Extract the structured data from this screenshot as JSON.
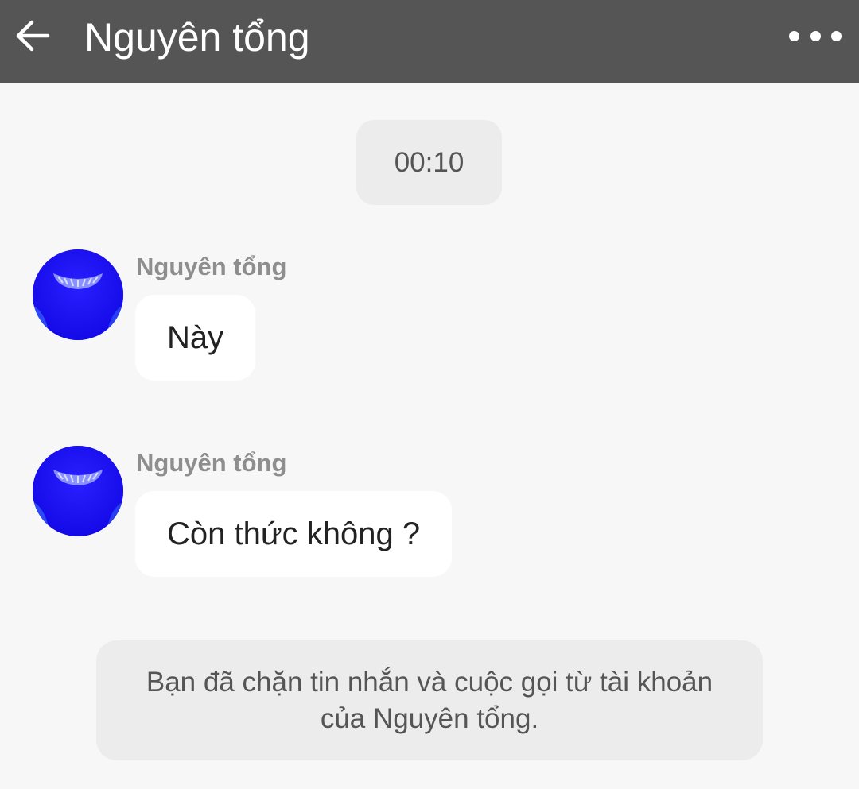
{
  "header": {
    "title": "Nguyên tổng",
    "back_icon": "arrow-left-icon",
    "more_icon": "more-horizontal-icon",
    "background_color": "#555555"
  },
  "chat": {
    "timestamp": "00:10",
    "messages": [
      {
        "sender": "Nguyên tổng",
        "text": "Này",
        "avatar": "blue-avatar"
      },
      {
        "sender": "Nguyên tổng",
        "text": "Còn thức không ?",
        "avatar": "blue-avatar"
      }
    ],
    "notice": {
      "line1": "Bạn đã chặn tin nhắn và cuộc gọi từ tài khoản",
      "line2": "của Nguyên tổng."
    }
  },
  "colors": {
    "background": "#f7f7f7",
    "bubble": "#ffffff",
    "chip": "#ececec",
    "avatar_blue": "#1a10ff"
  }
}
